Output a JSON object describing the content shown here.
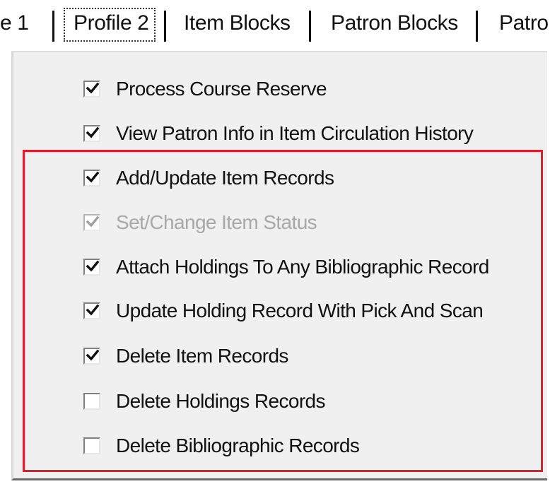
{
  "tabs": [
    {
      "label": "e 1"
    },
    {
      "label": "Profile 2",
      "active": true
    },
    {
      "label": "Item Blocks"
    },
    {
      "label": "Patron Blocks"
    },
    {
      "label": "Patro"
    }
  ],
  "permissions": [
    {
      "label": "Process Course Reserve",
      "checked": true,
      "enabled": true
    },
    {
      "label": "View Patron Info in Item Circulation History",
      "checked": true,
      "enabled": true
    },
    {
      "label": "Add/Update Item Records",
      "checked": true,
      "enabled": true
    },
    {
      "label": "Set/Change Item Status",
      "checked": true,
      "enabled": false
    },
    {
      "label": "Attach Holdings To Any Bibliographic Record",
      "checked": true,
      "enabled": true
    },
    {
      "label": "Update Holding Record With Pick And Scan",
      "checked": true,
      "enabled": true
    },
    {
      "label": "Delete Item Records",
      "checked": true,
      "enabled": true
    },
    {
      "label": "Delete Holdings Records",
      "checked": false,
      "enabled": true
    },
    {
      "label": "Delete Bibliographic Records",
      "checked": false,
      "enabled": true
    }
  ],
  "colors": {
    "highlight": "#e01e2b",
    "panel_bg": "#f0f0f0",
    "disabled_text": "#a8a8a8"
  }
}
